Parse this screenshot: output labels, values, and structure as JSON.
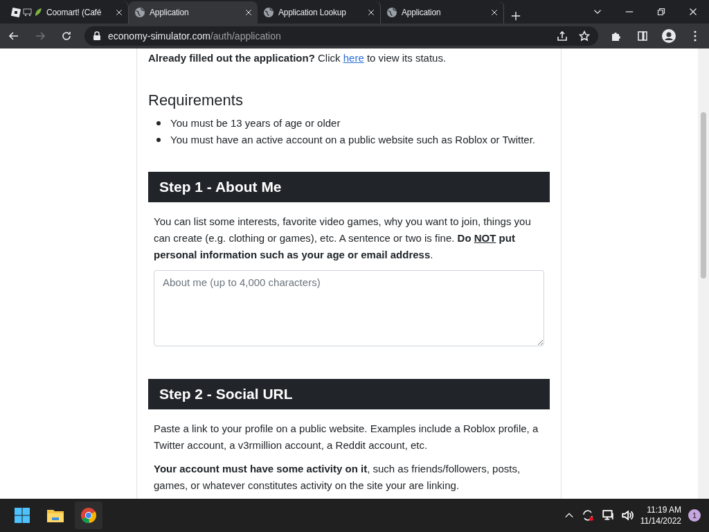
{
  "tabs": [
    {
      "title": "Coomart! (Café",
      "kind": "game",
      "selected": false
    },
    {
      "title": "Application",
      "kind": "globe",
      "selected": true
    },
    {
      "title": "Application Lookup",
      "kind": "globe",
      "selected": false
    },
    {
      "title": "Application",
      "kind": "globe",
      "selected": false
    }
  ],
  "address": {
    "host": "economy-simulator.com",
    "path": "/auth/application"
  },
  "intro": [
    {
      "text": "Already filled out the application?",
      "kind": "bold"
    },
    {
      "text": " Click ",
      "kind": "plain"
    },
    {
      "text": "here",
      "kind": "link"
    },
    {
      "text": " to view its status.",
      "kind": "plain"
    }
  ],
  "requirements": {
    "title": "Requirements",
    "items": [
      "You must be 13 years of age or older",
      "You must have an active account on a public website such as Roblox or Twitter."
    ]
  },
  "steps": [
    {
      "title": "Step 1 - About Me",
      "paragraphs": [
        [
          {
            "text": "You can list some interests, favorite video games, why you want to join, things you can create (e.g. clothing or games), etc. A sentence or two is fine. ",
            "kind": "plain"
          },
          {
            "text": "Do ",
            "kind": "bold"
          },
          {
            "text": "NOT",
            "kind": "bold-underline"
          },
          {
            "text": " put personal information such as your age or email address",
            "kind": "bold"
          },
          {
            "text": ".",
            "kind": "plain"
          }
        ]
      ],
      "field": {
        "placeholder": "About me (up to 4,000 characters)"
      }
    },
    {
      "title": "Step 2 - Social URL",
      "paragraphs": [
        [
          {
            "text": "Paste a link to your profile on a public website. Examples include a Roblox profile, a Twitter account, a v3rmillion account, a Reddit account, etc.",
            "kind": "plain"
          }
        ],
        [
          {
            "text": "Your account must have some activity on it",
            "kind": "bold"
          },
          {
            "text": ", such as friends/followers, posts, games, or whatever constitutes activity on the site your are linking.",
            "kind": "plain"
          }
        ]
      ]
    }
  ],
  "taskbar": {
    "time": "11:19 AM",
    "date": "11/14/2022",
    "notifications": "1"
  }
}
